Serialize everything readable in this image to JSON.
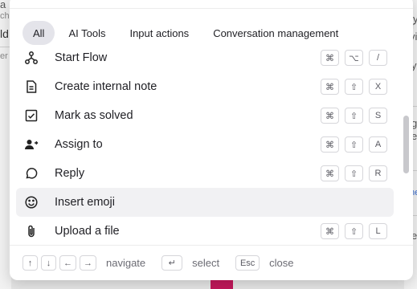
{
  "background": {
    "left_fragments": [
      "a",
      "ch",
      "ld",
      "er"
    ],
    "right_fragments": [
      "y",
      "r",
      "vi",
      "y",
      "g",
      "e",
      "he",
      "e"
    ]
  },
  "tabs": [
    {
      "label": "All",
      "active": true
    },
    {
      "label": "AI Tools",
      "active": false
    },
    {
      "label": "Input actions",
      "active": false
    },
    {
      "label": "Conversation management",
      "active": false
    }
  ],
  "commands": [
    {
      "label": "Start Flow",
      "icon": "flow-icon",
      "keys": [
        "⌘",
        "⌥",
        "/"
      ],
      "highlight": false
    },
    {
      "label": "Create internal note",
      "icon": "note-icon",
      "keys": [
        "⌘",
        "⇧",
        "X"
      ],
      "highlight": false
    },
    {
      "label": "Mark as solved",
      "icon": "check-square-icon",
      "keys": [
        "⌘",
        "⇧",
        "S"
      ],
      "highlight": false
    },
    {
      "label": "Assign to",
      "icon": "assign-user-icon",
      "keys": [
        "⌘",
        "⇧",
        "A"
      ],
      "highlight": false
    },
    {
      "label": "Reply",
      "icon": "chat-bubble-icon",
      "keys": [
        "⌘",
        "⇧",
        "R"
      ],
      "highlight": false
    },
    {
      "label": "Insert emoji",
      "icon": "emoji-icon",
      "keys": [],
      "highlight": true
    },
    {
      "label": "Upload a file",
      "icon": "paperclip-icon",
      "keys": [
        "⌘",
        "⇧",
        "L"
      ],
      "highlight": false
    }
  ],
  "footer": {
    "navigate_keys": [
      "↑",
      "↓",
      "←",
      "→"
    ],
    "navigate_label": "navigate",
    "select_key": "↵",
    "select_label": "select",
    "close_key": "Esc",
    "close_label": "close"
  }
}
